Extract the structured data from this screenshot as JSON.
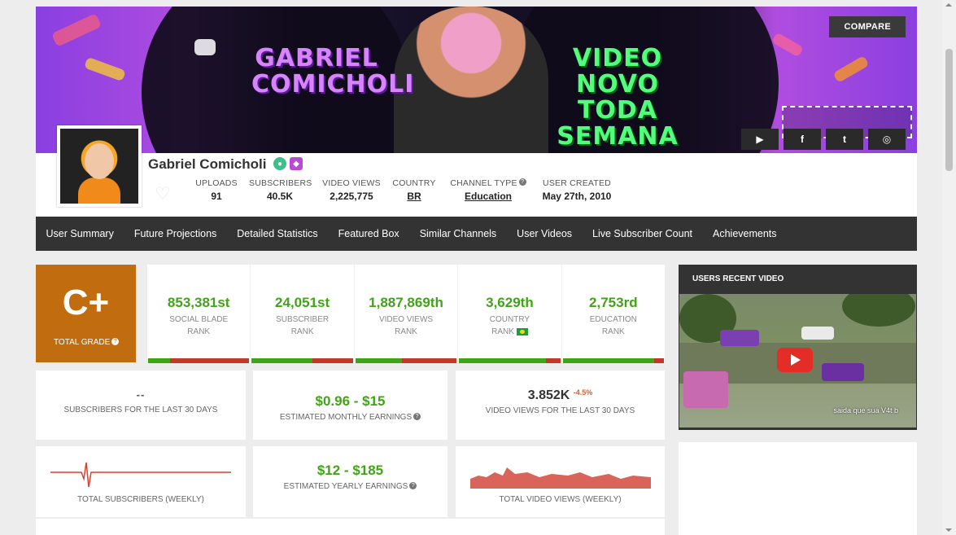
{
  "banner": {
    "title_left": "GABRIEL COMICHOLI",
    "title_right": "VIDEO NOVO TODA SEMANA",
    "compare_label": "COMPARE",
    "social_icons": [
      "youtube-icon",
      "facebook-icon",
      "twitter-icon",
      "instagram-icon"
    ],
    "social_glyphs": [
      "▶",
      "f",
      "t",
      "◎"
    ]
  },
  "channel": {
    "name": "Gabriel Comicholi",
    "stats": [
      {
        "label": "UPLOADS",
        "value": "91"
      },
      {
        "label": "SUBSCRIBERS",
        "value": "40.5K"
      },
      {
        "label": "VIDEO VIEWS",
        "value": "2,225,775"
      },
      {
        "label": "COUNTRY",
        "value": "BR"
      },
      {
        "label": "CHANNEL TYPE",
        "value": "Education"
      },
      {
        "label": "USER CREATED",
        "value": "May 27th, 2010"
      }
    ]
  },
  "nav": {
    "items": [
      "User Summary",
      "Future Projections",
      "Detailed Statistics",
      "Featured Box",
      "Similar Channels",
      "User Videos",
      "Live Subscriber Count",
      "Achievements"
    ]
  },
  "grade": {
    "letter": "C+",
    "label": "TOTAL GRADE"
  },
  "ranks": [
    {
      "num": "853,381st",
      "l1": "SOCIAL BLADE",
      "l2": "RANK",
      "fill": 0.22
    },
    {
      "num": "24,051st",
      "l1": "SUBSCRIBER",
      "l2": "RANK",
      "fill": 0.6
    },
    {
      "num": "1,887,869th",
      "l1": "VIDEO VIEWS",
      "l2": "RANK",
      "fill": 0.46
    },
    {
      "num": "3,629th",
      "l1": "COUNTRY",
      "l2": "RANK",
      "fill": 0.86
    },
    {
      "num": "2,753rd",
      "l1": "EDUCATION",
      "l2": "RANK",
      "fill": 0.9
    }
  ],
  "cards": {
    "subs30_value": "--",
    "subs30_label": "SUBSCRIBERS FOR THE LAST 30 DAYS",
    "monthly_value": "$0.96  -  $15",
    "monthly_label": "ESTIMATED MONTHLY EARNINGS",
    "views30_value": "3.852K",
    "views30_change": "-4.5%",
    "views30_label": "VIDEO VIEWS FOR THE LAST 30 DAYS",
    "total_subs_label": "TOTAL SUBSCRIBERS (WEEKLY)",
    "yearly_value": "$12  -  $185",
    "yearly_label": "ESTIMATED YEARLY EARNINGS",
    "total_views_label": "TOTAL VIDEO VIEWS (WEEKLY)"
  },
  "recent": {
    "title": "USERS RECENT VIDEO",
    "caption": "saida que sua V4t  b"
  },
  "colors": {
    "accent_green": "#41a317",
    "accent_red": "#c0392b",
    "grade_orange": "#c16c0e",
    "nav_dark": "#333333"
  }
}
